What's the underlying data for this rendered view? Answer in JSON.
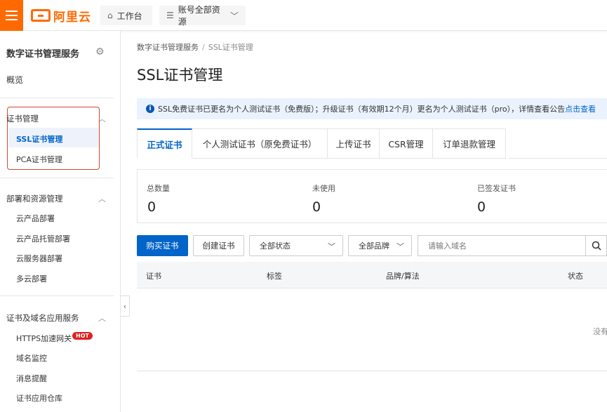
{
  "topbar": {
    "logo_text": "阿里云",
    "workbench_label": "工作台",
    "resources_label": "账号全部资源"
  },
  "sidebar": {
    "title": "数字证书管理服务",
    "overview": "概览",
    "groups": [
      {
        "label": "证书管理",
        "items": [
          "SSL证书管理",
          "PCA证书管理"
        ]
      },
      {
        "label": "部署和资源管理",
        "items": [
          "云产品部署",
          "云产品托管部署",
          "云服务器部署",
          "多云部署"
        ]
      },
      {
        "label": "证书及域名应用服务",
        "items": [
          "HTTPS加速网关",
          "域名监控",
          "消息提醒",
          "证书应用仓库"
        ]
      }
    ],
    "hot_badge": "HOT"
  },
  "breadcrumb": {
    "root": "数字证书管理服务",
    "separator": "/",
    "current": "SSL证书管理"
  },
  "page_title": "SSL证书管理",
  "notice": {
    "text": "SSL免费证书已更名为个人测试证书（免费版）；升级证书（有效期12个月）更名为个人测试证书（pro），详情查看公告",
    "link": "点击查看"
  },
  "tabs": [
    {
      "label": "正式证书",
      "active": true
    },
    {
      "label": "个人测试证书（原免费证书）",
      "active": false
    },
    {
      "label": "上传证书",
      "active": false
    },
    {
      "label": "CSR管理",
      "active": false
    },
    {
      "label": "订单退款管理",
      "active": false
    }
  ],
  "stats": [
    {
      "label": "总数量",
      "value": "0"
    },
    {
      "label": "未使用",
      "value": "0"
    },
    {
      "label": "已签发证书",
      "value": "0"
    }
  ],
  "toolbar": {
    "buy_label": "购买证书",
    "create_label": "创建证书",
    "status_select": "全部状态",
    "brand_select": "全部品牌",
    "search_placeholder": "请输入域名"
  },
  "table": {
    "columns": [
      "证书",
      "标签",
      "品牌/算法",
      "状态"
    ],
    "empty_text": "没有"
  },
  "colors": {
    "brand_orange": "#ff6a00",
    "primary_blue": "#0064c8",
    "highlight_red": "#d0492e"
  }
}
